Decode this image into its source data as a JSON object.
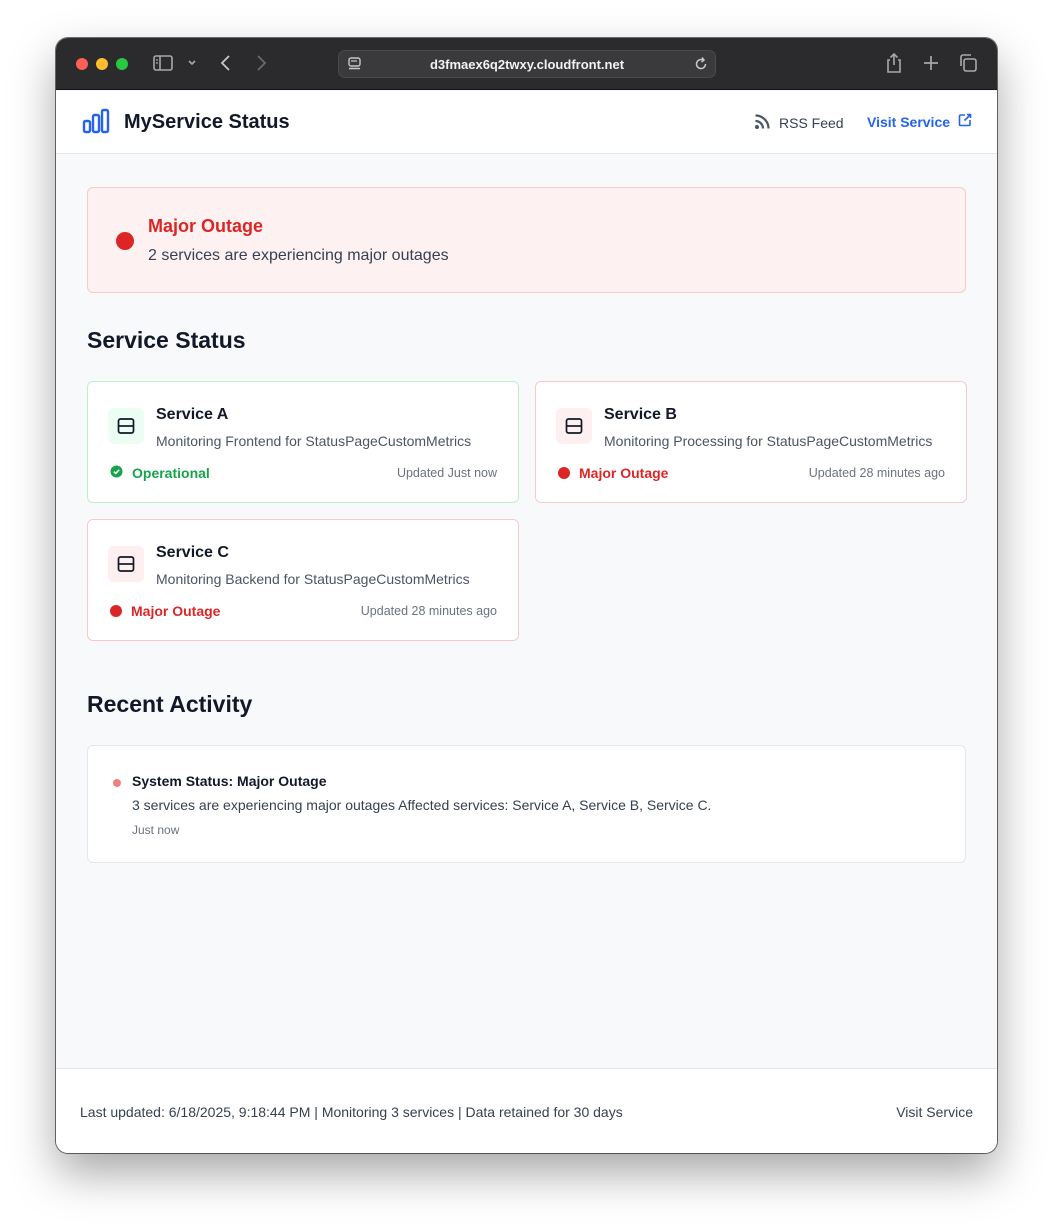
{
  "browser": {
    "url": "d3fmaex6q2twxy.cloudfront.net"
  },
  "header": {
    "title": "MyService Status",
    "rss_label": "RSS Feed",
    "visit_label": "Visit Service"
  },
  "banner": {
    "title": "Major Outage",
    "message": "2 services are experiencing major outages"
  },
  "services_section": {
    "title": "Service Status",
    "services": [
      {
        "name": "Service A",
        "description": "Monitoring Frontend for StatusPageCustomMetrics",
        "status": "Operational",
        "updated": "Updated Just now"
      },
      {
        "name": "Service B",
        "description": "Monitoring Processing for StatusPageCustomMetrics",
        "status": "Major Outage",
        "updated": "Updated 28 minutes ago"
      },
      {
        "name": "Service C",
        "description": "Monitoring Backend for StatusPageCustomMetrics",
        "status": "Major Outage",
        "updated": "Updated 28 minutes ago"
      }
    ]
  },
  "activity_section": {
    "title": "Recent Activity",
    "items": [
      {
        "title": "System Status: Major Outage",
        "message": "3 services are experiencing major outages Affected services: Service A, Service B, Service C.",
        "time": "Just now"
      }
    ]
  },
  "footer": {
    "text": "Last updated: 6/18/2025, 9:18:44 PM | Monitoring 3 services | Data retained for 30 days",
    "link_label": "Visit Service"
  },
  "colors": {
    "brand_blue": "#2563eb",
    "outage_red": "#dc2626",
    "operational_green": "#16a34a"
  }
}
